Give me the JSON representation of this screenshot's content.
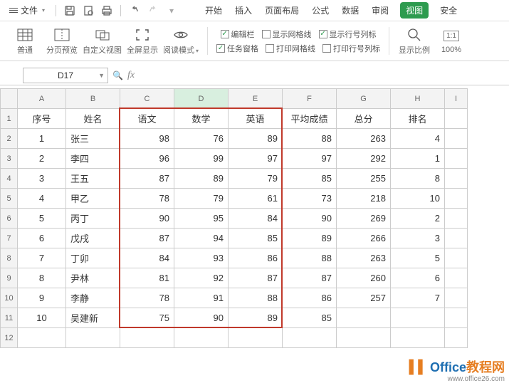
{
  "menubar": {
    "file_label": "文件",
    "tabs": [
      "开始",
      "插入",
      "页面布局",
      "公式",
      "数据",
      "审阅",
      "视图",
      "安全"
    ],
    "active_tab_index": 6
  },
  "ribbon": {
    "normal": "普通",
    "preview": "分页预览",
    "custom_view": "自定义视图",
    "fullscreen": "全屏显示",
    "read_mode": "阅读模式",
    "checks": {
      "edit_bar": {
        "label": "编辑栏",
        "checked": true
      },
      "show_grid": {
        "label": "显示网格线",
        "checked": false
      },
      "show_rowcol": {
        "label": "显示行号列标",
        "checked": true
      },
      "task_pane": {
        "label": "任务窗格",
        "checked": true
      },
      "print_grid": {
        "label": "打印网格线",
        "checked": false
      },
      "print_rowcol": {
        "label": "打印行号列标",
        "checked": false
      }
    },
    "zoom_ratio": "显示比例",
    "zoom_100": "100%"
  },
  "namebox": "D17",
  "fx_label": "fx",
  "columns": [
    "A",
    "B",
    "C",
    "D",
    "E",
    "F",
    "G",
    "H",
    "I"
  ],
  "selected_col_index": 3,
  "row_header_count": 12,
  "headers": {
    "A": "序号",
    "B": "姓名",
    "C": "语文",
    "D": "数学",
    "E": "英语",
    "F": "平均成绩",
    "G": "总分",
    "H": "排名"
  },
  "data_rows": [
    {
      "A": "1",
      "B": "张三",
      "C": "98",
      "D": "76",
      "E": "89",
      "F": "88",
      "G": "263",
      "H": "4"
    },
    {
      "A": "2",
      "B": "李四",
      "C": "96",
      "D": "99",
      "E": "97",
      "F": "97",
      "G": "292",
      "H": "1"
    },
    {
      "A": "3",
      "B": "王五",
      "C": "87",
      "D": "89",
      "E": "79",
      "F": "85",
      "G": "255",
      "H": "8"
    },
    {
      "A": "4",
      "B": "甲乙",
      "C": "78",
      "D": "79",
      "E": "61",
      "F": "73",
      "G": "218",
      "H": "10"
    },
    {
      "A": "5",
      "B": "丙丁",
      "C": "90",
      "D": "95",
      "E": "84",
      "F": "90",
      "G": "269",
      "H": "2"
    },
    {
      "A": "6",
      "B": "戊戌",
      "C": "87",
      "D": "94",
      "E": "85",
      "F": "89",
      "G": "266",
      "H": "3"
    },
    {
      "A": "7",
      "B": "丁卯",
      "C": "84",
      "D": "93",
      "E": "86",
      "F": "88",
      "G": "263",
      "H": "5"
    },
    {
      "A": "8",
      "B": "尹林",
      "C": "81",
      "D": "92",
      "E": "87",
      "F": "87",
      "G": "260",
      "H": "6"
    },
    {
      "A": "9",
      "B": "李静",
      "C": "78",
      "D": "91",
      "E": "88",
      "F": "86",
      "G": "257",
      "H": "7"
    },
    {
      "A": "10",
      "B": "吴建新",
      "C": "75",
      "D": "90",
      "E": "89",
      "F": "85",
      "G": "",
      "H": ""
    }
  ],
  "watermark": {
    "brand": "Office",
    "suffix": "教程网",
    "url": "www.office26.com"
  }
}
